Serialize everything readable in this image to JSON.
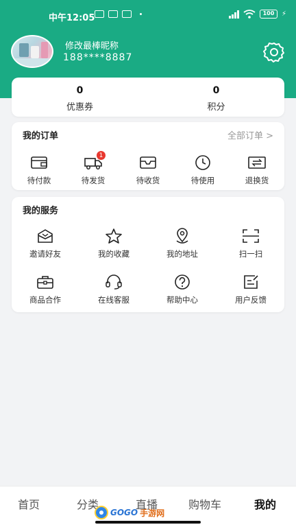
{
  "status_bar": {
    "time": "中午12:05",
    "battery": "100"
  },
  "profile": {
    "nickname": "修改最棒昵称",
    "phone": "188****8887"
  },
  "stats": [
    {
      "value": "0",
      "label": "优惠券"
    },
    {
      "value": "0",
      "label": "积分"
    }
  ],
  "orders": {
    "title": "我的订单",
    "view_all": "全部订单 >",
    "items": [
      {
        "label": "待付款",
        "icon": "wallet-icon"
      },
      {
        "label": "待发货",
        "icon": "truck-icon",
        "badge": "1"
      },
      {
        "label": "待收货",
        "icon": "inbox-icon"
      },
      {
        "label": "待使用",
        "icon": "clock-icon"
      },
      {
        "label": "退换货",
        "icon": "exchange-icon"
      }
    ]
  },
  "services": {
    "title": "我的服务",
    "items": [
      {
        "label": "邀请好友",
        "icon": "envelope-icon"
      },
      {
        "label": "我的收藏",
        "icon": "star-icon"
      },
      {
        "label": "我的地址",
        "icon": "location-icon"
      },
      {
        "label": "扫一扫",
        "icon": "scan-icon"
      },
      {
        "label": "商品合作",
        "icon": "briefcase-icon"
      },
      {
        "label": "在线客服",
        "icon": "headset-icon"
      },
      {
        "label": "帮助中心",
        "icon": "help-icon"
      },
      {
        "label": "用户反馈",
        "icon": "feedback-icon"
      }
    ]
  },
  "bottom_nav": [
    {
      "label": "首页",
      "active": false
    },
    {
      "label": "分类",
      "active": false
    },
    {
      "label": "直播",
      "active": false
    },
    {
      "label": "购物车",
      "active": false
    },
    {
      "label": "我的",
      "active": true
    }
  ],
  "watermark": {
    "text_a": "GOGO",
    "text_b": "手游网"
  },
  "colors": {
    "brand": "#1aab84",
    "badge": "#e8382f",
    "background": "#f2f3f5"
  }
}
